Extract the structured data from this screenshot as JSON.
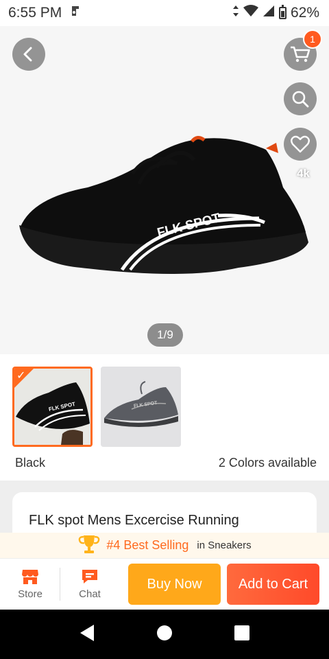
{
  "status_bar": {
    "time": "6:55 PM",
    "battery": "62%"
  },
  "hero": {
    "pager": "1/9",
    "cart_count": "1",
    "wishlist_count": "4k",
    "shoe_brand_print": "FLK SPOT"
  },
  "variants": {
    "selected_color": "Black",
    "colors_available": "2 Colors available",
    "thumb_brand_print": "FLK SPOT"
  },
  "product": {
    "title": "FLK spot Mens Excercise  Running"
  },
  "best_selling": {
    "rank": "#4 Best Selling",
    "category": "in Sneakers"
  },
  "action_bar": {
    "store_label": "Store",
    "chat_label": "Chat",
    "buy_now_label": "Buy Now",
    "add_to_cart_label": "Add to Cart"
  },
  "colors": {
    "accent_orange": "#ff6a1f",
    "buy_now": "#ffa81a",
    "add_to_cart": "#ff5330"
  }
}
